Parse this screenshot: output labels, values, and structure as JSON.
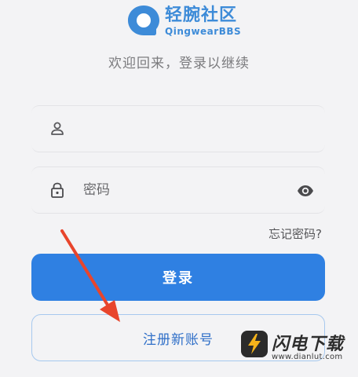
{
  "brand": {
    "name_cn": "轻腕社区",
    "name_en": "QingwearBBS",
    "accent_color": "#3d8bd8"
  },
  "subtitle": "欢迎回来，登录以继续",
  "username_field": {
    "icon": "user-icon",
    "value": "",
    "placeholder": ""
  },
  "password_field": {
    "icon": "lock-icon",
    "value": "",
    "placeholder": "密码",
    "toggle_icon": "eye-icon"
  },
  "forgot_password": "忘记密码?",
  "login_button": {
    "label": "登录",
    "color": "#2f80e2"
  },
  "register_button": {
    "label": "注册新账号"
  },
  "watermark": {
    "name": "闪电下载",
    "url": "www.dianlut.com"
  }
}
